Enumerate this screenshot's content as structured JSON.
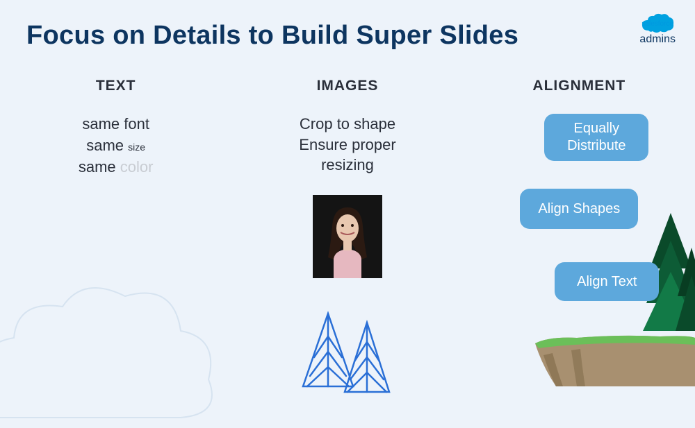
{
  "title": "Focus on Details to Build Super Slides",
  "logo": {
    "brand": "salesforce",
    "sub": "admins"
  },
  "columns": {
    "text": {
      "header": "TEXT",
      "line1_prefix": "same ",
      "line1_word": "font",
      "line2_prefix": "same ",
      "line2_word": "size",
      "line3_prefix": "same ",
      "line3_word": "color"
    },
    "images": {
      "header": "IMAGES",
      "line1": "Crop to shape",
      "line2a": "Ensure proper",
      "line2b": "resizing"
    },
    "alignment": {
      "header": "ALIGNMENT",
      "pill1a": "Equally",
      "pill1b": "Distribute",
      "pill2": "Align Shapes",
      "pill3": "Align Text"
    }
  }
}
